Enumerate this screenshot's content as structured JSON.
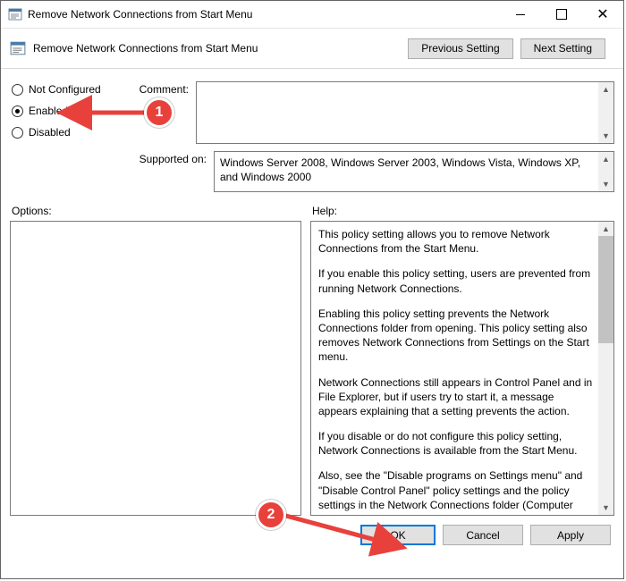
{
  "window": {
    "title": "Remove Network Connections from Start Menu"
  },
  "header": {
    "policy_name": "Remove Network Connections from Start Menu",
    "prev_btn": "Previous Setting",
    "next_btn": "Next Setting"
  },
  "radios": {
    "not_configured": "Not Configured",
    "enabled": "Enabled",
    "disabled": "Disabled",
    "selected": "enabled"
  },
  "comment": {
    "label": "Comment:",
    "value": ""
  },
  "supported": {
    "label": "Supported on:",
    "value": "Windows Server 2008, Windows Server 2003, Windows Vista, Windows XP, and Windows 2000"
  },
  "panes": {
    "options_label": "Options:",
    "help_label": "Help:"
  },
  "help": {
    "p1": "This policy setting allows you to remove Network Connections from the Start Menu.",
    "p2": "If you enable this policy setting, users are prevented from running Network Connections.",
    "p3": "Enabling this policy setting prevents the Network Connections folder from opening. This policy setting also removes Network Connections from Settings on the Start menu.",
    "p4": "Network Connections still appears in Control Panel and in File Explorer, but if users try to start it, a message appears explaining that a setting prevents the action.",
    "p5": "If you disable or do not configure this policy setting, Network Connections is available from the Start Menu.",
    "p6": "Also, see the \"Disable programs on Settings menu\" and \"Disable Control Panel\" policy settings and the policy settings in the Network Connections folder (Computer Configuration and User Configuration\\Administrative Templates\\Network\\Network"
  },
  "footer": {
    "ok": "OK",
    "cancel": "Cancel",
    "apply": "Apply"
  },
  "annotations": {
    "callout1": "1",
    "callout2": "2"
  }
}
